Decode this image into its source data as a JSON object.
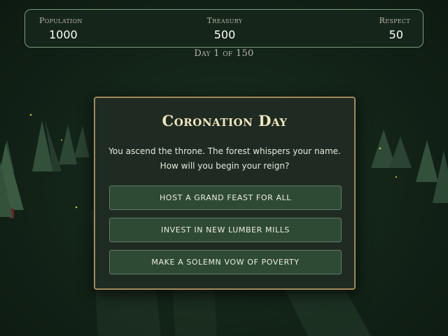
{
  "stats": {
    "population": {
      "label": "Population",
      "value": "1000"
    },
    "treasury": {
      "label": "Treasury",
      "value": "500"
    },
    "respect": {
      "label": "Respect",
      "value": "50"
    }
  },
  "day_counter": "Day 1 of 150",
  "event": {
    "title": "Coronation Day",
    "description": "You ascend the throne. The forest whispers your name. How will you begin your reign?",
    "choices": [
      {
        "label": "HOST A GRAND FEAST FOR ALL"
      },
      {
        "label": "INVEST IN NEW LUMBER MILLS"
      },
      {
        "label": "MAKE A SOLEMN VOW OF POVERTY"
      }
    ]
  },
  "colors": {
    "background": "#142519",
    "panel_border": "#7a9a7e",
    "card_border": "#a08a5c",
    "title": "#f1e6bf",
    "button_fill": "#2e4a35",
    "firefly": "#c9c33a"
  }
}
